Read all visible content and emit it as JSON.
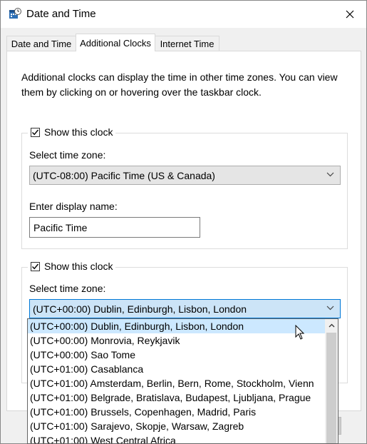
{
  "window": {
    "title": "Date and Time"
  },
  "tabs": [
    {
      "label": "Date and Time",
      "active": false
    },
    {
      "label": "Additional Clocks",
      "active": true
    },
    {
      "label": "Internet Time",
      "active": false
    }
  ],
  "description": "Additional clocks can display the time in other time zones. You can view them by clicking on or hovering over the taskbar clock.",
  "clock1": {
    "show_label": "Show this clock",
    "checked": true,
    "timezone_label": "Select time zone:",
    "timezone_value": "(UTC-08:00) Pacific Time (US & Canada)",
    "display_name_label": "Enter display name:",
    "display_name_value": "Pacific Time"
  },
  "clock2": {
    "show_label": "Show this clock",
    "checked": true,
    "timezone_label": "Select time zone:",
    "timezone_value": "(UTC+00:00) Dublin, Edinburgh, Lisbon, London"
  },
  "timezone_options": [
    "(UTC+00:00) Dublin, Edinburgh, Lisbon, London",
    "(UTC+00:00) Monrovia, Reykjavik",
    "(UTC+00:00) Sao Tome",
    "(UTC+01:00) Casablanca",
    "(UTC+01:00) Amsterdam, Berlin, Bern, Rome, Stockholm, Vienn",
    "(UTC+01:00) Belgrade, Bratislava, Budapest, Ljubljana, Prague",
    "(UTC+01:00) Brussels, Copenhagen, Madrid, Paris",
    "(UTC+01:00) Sarajevo, Skopje, Warsaw, Zagreb",
    "(UTC+01:00) West Central Africa"
  ],
  "selected_option_index": 0,
  "colors": {
    "focus_blue": "#0078d7",
    "selection_bg": "#cce8ff",
    "combo_focus_bg": "#cce4f7"
  }
}
